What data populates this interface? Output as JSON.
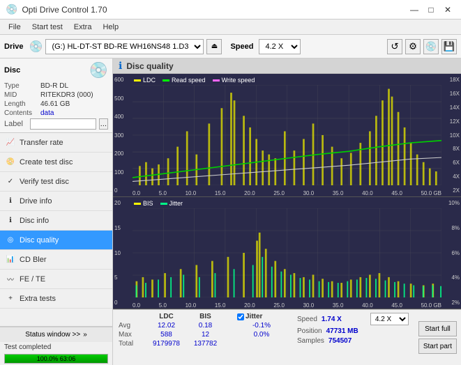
{
  "app": {
    "title": "Opti Drive Control 1.70",
    "icon": "💿",
    "min_btn": "—",
    "max_btn": "□",
    "close_btn": "✕"
  },
  "menubar": {
    "items": [
      "File",
      "Start test",
      "Extra",
      "Help"
    ]
  },
  "toolbar": {
    "drive_label": "Drive",
    "drive_value": "(G:) HL-DT-ST BD-RE  WH16NS48 1.D3",
    "speed_label": "Speed",
    "speed_value": "4.2 X"
  },
  "sidebar": {
    "disc_title": "Disc",
    "disc_info": {
      "type_label": "Type",
      "type_value": "BD-R DL",
      "mid_label": "MID",
      "mid_value": "RITEKDR3 (000)",
      "length_label": "Length",
      "length_value": "46.61 GB",
      "contents_label": "Contents",
      "contents_value": "data",
      "label_label": "Label",
      "label_placeholder": ""
    },
    "nav_items": [
      {
        "id": "transfer-rate",
        "label": "Transfer rate",
        "active": false
      },
      {
        "id": "create-test-disc",
        "label": "Create test disc",
        "active": false
      },
      {
        "id": "verify-test-disc",
        "label": "Verify test disc",
        "active": false
      },
      {
        "id": "drive-info",
        "label": "Drive info",
        "active": false
      },
      {
        "id": "disc-info",
        "label": "Disc info",
        "active": false
      },
      {
        "id": "disc-quality",
        "label": "Disc quality",
        "active": true
      },
      {
        "id": "cd-bler",
        "label": "CD Bler",
        "active": false
      },
      {
        "id": "fe-te",
        "label": "FE / TE",
        "active": false
      },
      {
        "id": "extra-tests",
        "label": "Extra tests",
        "active": false
      }
    ],
    "status_window_btn": "Status window >>",
    "status_text": "Test completed",
    "progress_value": "100.0%",
    "progress_num": "63:06"
  },
  "quality": {
    "title": "Disc quality",
    "legend": {
      "ldc": "LDC",
      "read": "Read speed",
      "write": "Write speed",
      "bis": "BIS",
      "jitter": "Jitter"
    },
    "chart1": {
      "y_max": 600,
      "y_right_labels": [
        "18X",
        "16X",
        "14X",
        "12X",
        "10X",
        "8X",
        "6X",
        "4X",
        "2X"
      ],
      "y_left_labels": [
        "600",
        "500",
        "400",
        "300",
        "200",
        "100",
        "0"
      ],
      "x_labels": [
        "0.0",
        "5.0",
        "10.0",
        "15.0",
        "20.0",
        "25.0",
        "30.0",
        "35.0",
        "40.0",
        "45.0",
        "50.0 GB"
      ]
    },
    "chart2": {
      "y_left_labels": [
        "20",
        "15",
        "10",
        "5",
        "0"
      ],
      "y_right_labels": [
        "10%",
        "8%",
        "6%",
        "4%",
        "2%"
      ],
      "x_labels": [
        "0.0",
        "5.0",
        "10.0",
        "15.0",
        "20.0",
        "25.0",
        "30.0",
        "35.0",
        "40.0",
        "45.0",
        "50.0 GB"
      ]
    },
    "stats": {
      "headers": [
        "",
        "LDC",
        "BIS",
        "",
        "Jitter",
        "Speed"
      ],
      "avg_label": "Avg",
      "avg_ldc": "12.02",
      "avg_bis": "0.18",
      "avg_jitter": "-0.1%",
      "max_label": "Max",
      "max_ldc": "588",
      "max_bis": "12",
      "max_jitter": "0.0%",
      "total_label": "Total",
      "total_ldc": "9179978",
      "total_bis": "137782",
      "jitter_checked": true,
      "speed_label": "Speed",
      "speed_value": "1.74 X",
      "speed_select": "4.2 X",
      "position_label": "Position",
      "position_value": "47731 MB",
      "samples_label": "Samples",
      "samples_value": "754507"
    },
    "buttons": {
      "start_full": "Start full",
      "start_part": "Start part"
    }
  }
}
